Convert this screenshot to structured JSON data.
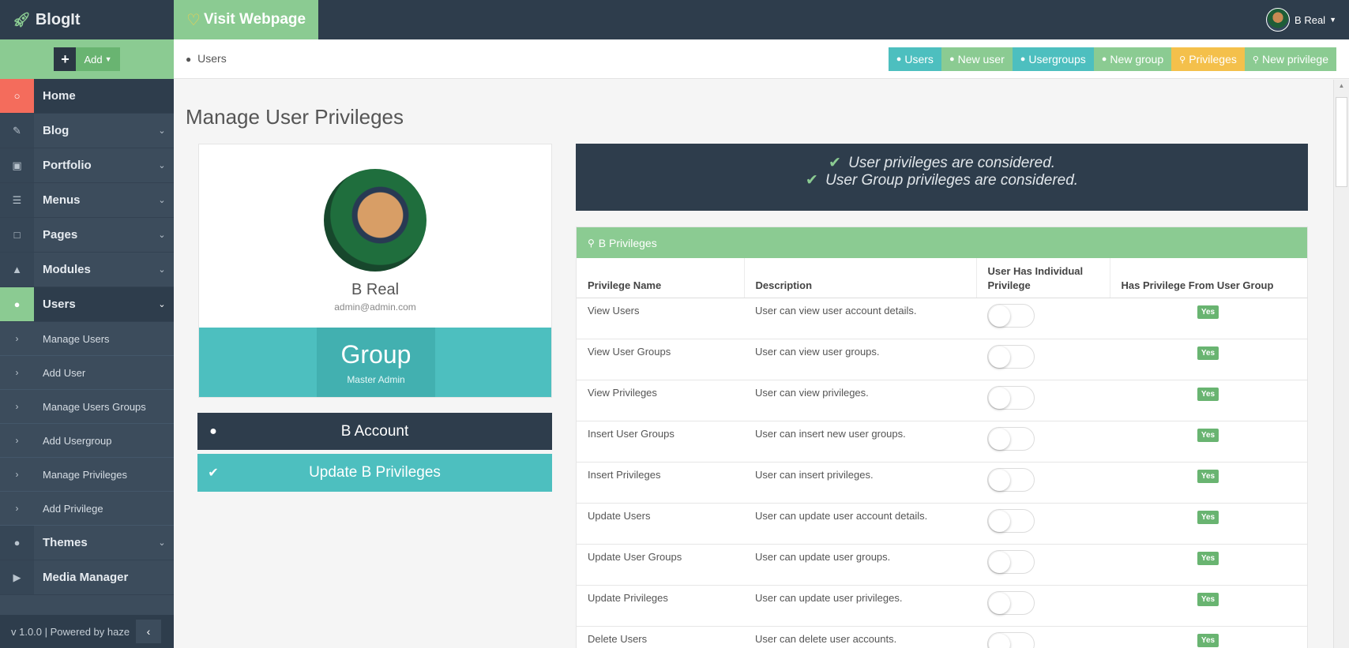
{
  "brand": {
    "name": "BlogIt",
    "icon": "rocket-icon"
  },
  "add": {
    "label": "Add"
  },
  "topbar": {
    "visit_label": "Visit Webpage",
    "user_name": "B Real"
  },
  "sidebar": {
    "items": [
      {
        "label": "Home",
        "icon": "lightbulb-icon"
      },
      {
        "label": "Blog",
        "icon": "edit-icon"
      },
      {
        "label": "Portfolio",
        "icon": "briefcase-icon"
      },
      {
        "label": "Menus",
        "icon": "list-icon"
      },
      {
        "label": "Pages",
        "icon": "file-icon"
      },
      {
        "label": "Modules",
        "icon": "sitemap-icon"
      },
      {
        "label": "Users",
        "icon": "users-icon"
      }
    ],
    "sub_items": [
      {
        "label": "Manage Users"
      },
      {
        "label": "Add User"
      },
      {
        "label": "Manage Users Groups"
      },
      {
        "label": "Add Usergroup"
      },
      {
        "label": "Manage Privileges"
      },
      {
        "label": "Add Privilege"
      }
    ],
    "items_after": [
      {
        "label": "Themes",
        "icon": "tint-icon"
      },
      {
        "label": "Media Manager",
        "icon": "video-icon"
      }
    ],
    "footer": "v 1.0.0 | Powered by haze"
  },
  "breadcrumb": {
    "label": "Users"
  },
  "quick_links": [
    {
      "label": "Users",
      "color": "#4dbfbf"
    },
    {
      "label": "New user",
      "color": "#8bcb92"
    },
    {
      "label": "Usergroups",
      "color": "#4dbfbf"
    },
    {
      "label": "New group",
      "color": "#8bcb92"
    },
    {
      "label": "Privileges",
      "color": "#f4c04b"
    },
    {
      "label": "New privilege",
      "color": "#8bcb92"
    }
  ],
  "page": {
    "title": "Manage User Privileges",
    "profile": {
      "name": "B Real",
      "email": "admin@admin.com",
      "group_label": "Group",
      "group_name": "Master Admin"
    },
    "account_button": "B Account",
    "update_button": "Update B Privileges",
    "alerts": [
      "User privileges are considered.",
      "User Group privileges are considered."
    ],
    "panel_title": "B Privileges",
    "columns": [
      "Privilege Name",
      "Description",
      "User Has Individual Privilege",
      "Has Privilege From User Group"
    ],
    "rows": [
      {
        "name": "View Users",
        "desc": "User can view user account details.",
        "individual": false,
        "group": "Yes"
      },
      {
        "name": "View User Groups",
        "desc": "User can view user groups.",
        "individual": false,
        "group": "Yes"
      },
      {
        "name": "View Privileges",
        "desc": "User can view privileges.",
        "individual": false,
        "group": "Yes"
      },
      {
        "name": "Insert User Groups",
        "desc": "User can insert new user groups.",
        "individual": false,
        "group": "Yes"
      },
      {
        "name": "Insert Privileges",
        "desc": "User can insert privileges.",
        "individual": false,
        "group": "Yes"
      },
      {
        "name": "Update Users",
        "desc": "User can update user account details.",
        "individual": false,
        "group": "Yes"
      },
      {
        "name": "Update User Groups",
        "desc": "User can update user groups.",
        "individual": false,
        "group": "Yes"
      },
      {
        "name": "Update Privileges",
        "desc": "User can update user privileges.",
        "individual": false,
        "group": "Yes"
      },
      {
        "name": "Delete Users",
        "desc": "User can delete user accounts.",
        "individual": false,
        "group": "Yes"
      }
    ]
  }
}
